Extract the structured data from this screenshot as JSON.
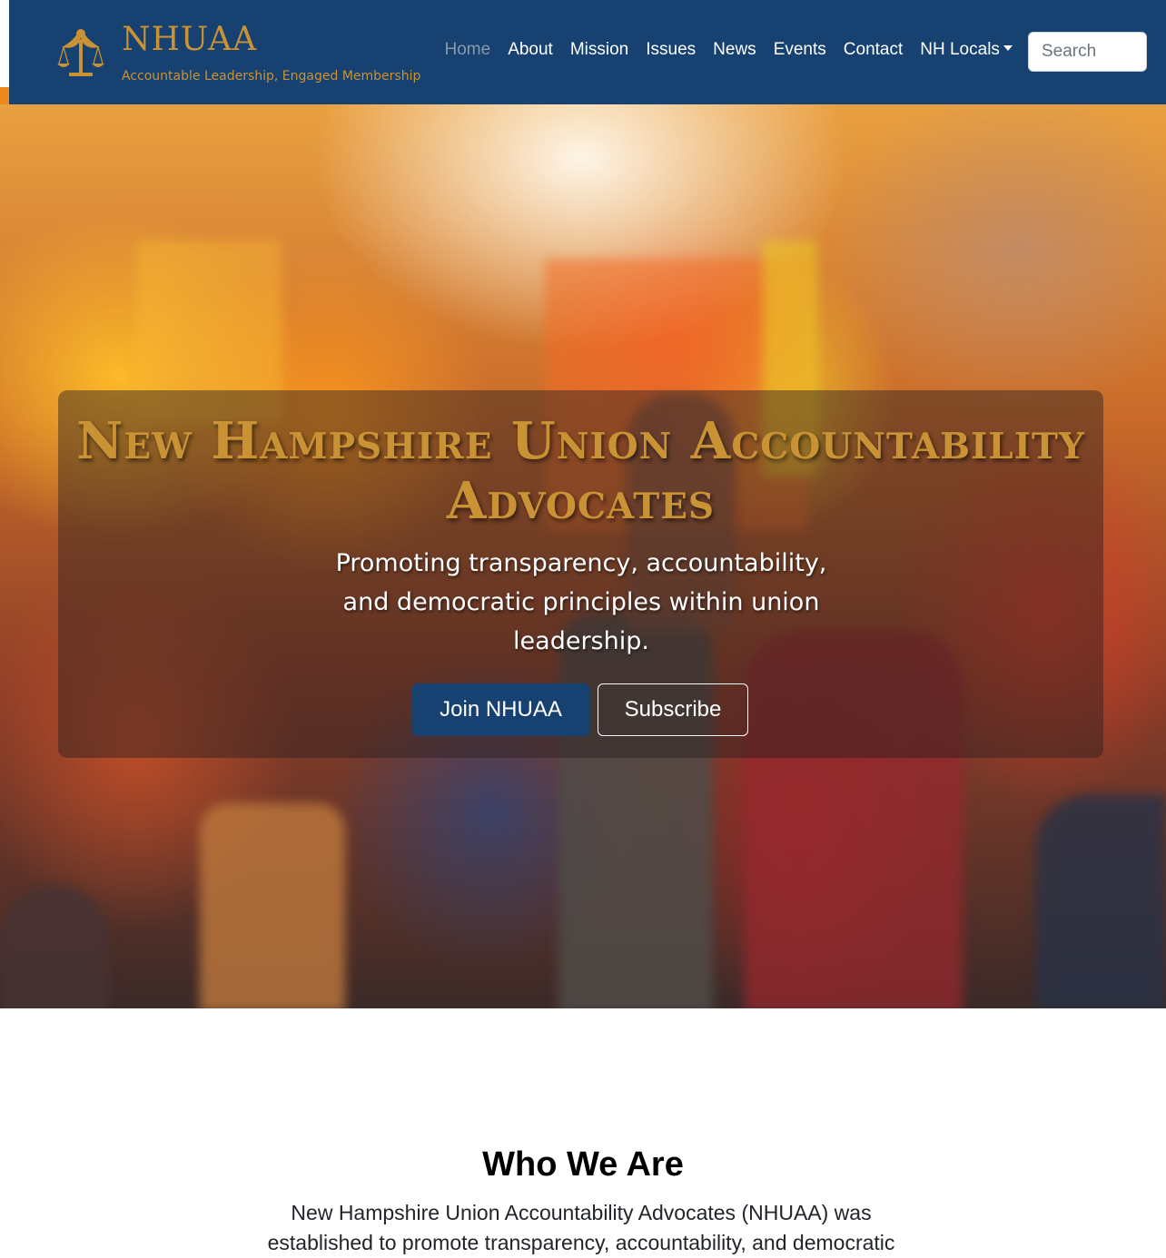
{
  "brand": {
    "name": "NHUAA",
    "tagline": "Accountable Leadership, Engaged Membership",
    "logo_icon": "scales-of-justice-person-icon",
    "color": "#c99335"
  },
  "nav": {
    "items": [
      {
        "label": "Home",
        "active": true
      },
      {
        "label": "About"
      },
      {
        "label": "Mission"
      },
      {
        "label": "Issues"
      },
      {
        "label": "News"
      },
      {
        "label": "Events"
      },
      {
        "label": "Contact"
      },
      {
        "label": "NH Locals",
        "dropdown": true
      }
    ],
    "background": "#164170"
  },
  "search": {
    "placeholder": "Search",
    "value": ""
  },
  "hero": {
    "title": "New Hampshire Union Accountability Advocates",
    "subtitle": "Promoting transparency, accountability, and democratic principles within union leadership.",
    "primary_button": "Join NHUAA",
    "secondary_button": "Subscribe"
  },
  "who_we_are": {
    "title": "Who We Are",
    "text": "New Hampshire Union Accountability Advocates (NHUAA) was established to promote transparency, accountability, and democratic"
  }
}
